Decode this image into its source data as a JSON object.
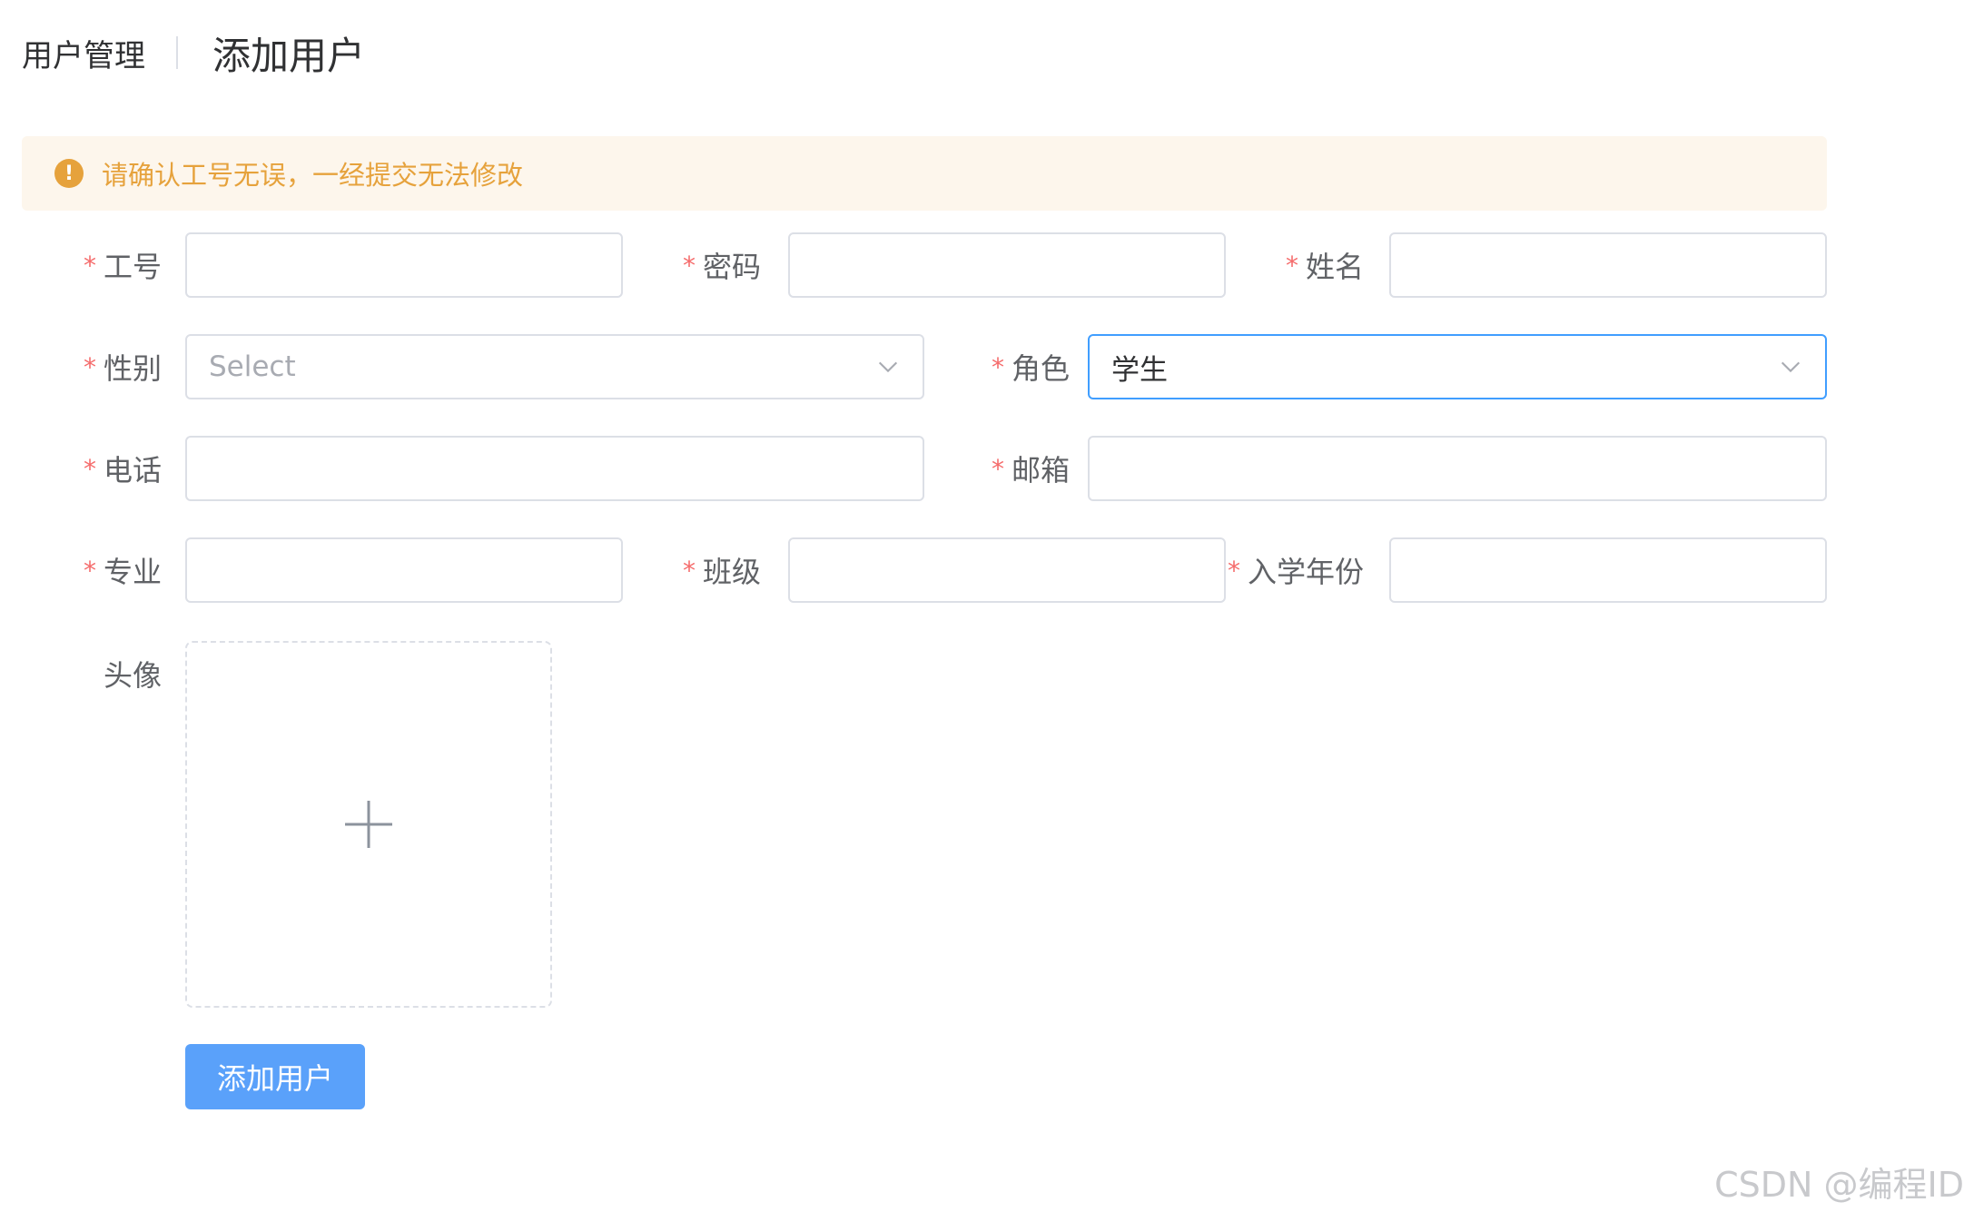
{
  "header": {
    "parent": "用户管理",
    "title": "添加用户"
  },
  "alert": {
    "icon": "warning-icon",
    "text": "请确认工号无误，一经提交无法修改"
  },
  "form": {
    "job_no": {
      "label": "工号",
      "value": ""
    },
    "password": {
      "label": "密码",
      "value": ""
    },
    "name": {
      "label": "姓名",
      "value": ""
    },
    "gender": {
      "label": "性别",
      "placeholder": "Select"
    },
    "role": {
      "label": "角色",
      "value": "学生"
    },
    "phone": {
      "label": "电话",
      "value": ""
    },
    "email": {
      "label": "邮箱",
      "value": ""
    },
    "major": {
      "label": "专业",
      "value": ""
    },
    "class": {
      "label": "班级",
      "value": ""
    },
    "enroll_year": {
      "label": "入学年份",
      "value": ""
    },
    "avatar": {
      "label": "头像"
    },
    "required_mark": "*"
  },
  "submit_label": "添加用户",
  "watermark": "CSDN @编程ID",
  "colors": {
    "primary": "#409eff",
    "button": "#5aa1fa",
    "warning": "#e6a23c",
    "warning_bg": "#fdf6ec",
    "required": "#f56c6c"
  }
}
